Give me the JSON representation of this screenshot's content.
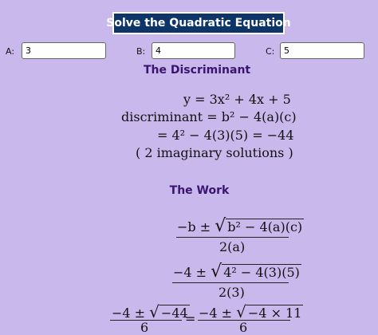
{
  "header": {
    "title": "Solve the Quadratic Equation"
  },
  "inputs": {
    "a": {
      "label": "A:",
      "value": "3"
    },
    "b": {
      "label": "B:",
      "value": "4"
    },
    "c": {
      "label": "C:",
      "value": "5"
    }
  },
  "discriminant": {
    "heading": "The Discriminant",
    "line1": "y = 3x² + 4x + 5",
    "line2": "discriminant  = b² − 4(a)(c)",
    "line3": "= 4² − 4(3)(5) = −44",
    "line4": "( 2 imaginary solutions )"
  },
  "work": {
    "heading": "The Work",
    "step1_num_prefix": "−b ±",
    "step1_radicand": "b² − 4(a)(c)",
    "step1_den": "2(a)",
    "step2_num_prefix": "−4 ±",
    "step2_radicand": "4² − 4(3)(5)",
    "step2_den": "2(3)",
    "step3_left_num_prefix": "−4 ±",
    "step3_left_radicand": "−44",
    "step3_left_den": "6",
    "step3_eq": "=",
    "step3_right_num_prefix": "−4 ±",
    "step3_right_radicand": "−4 × 11",
    "step3_right_den": "6"
  }
}
